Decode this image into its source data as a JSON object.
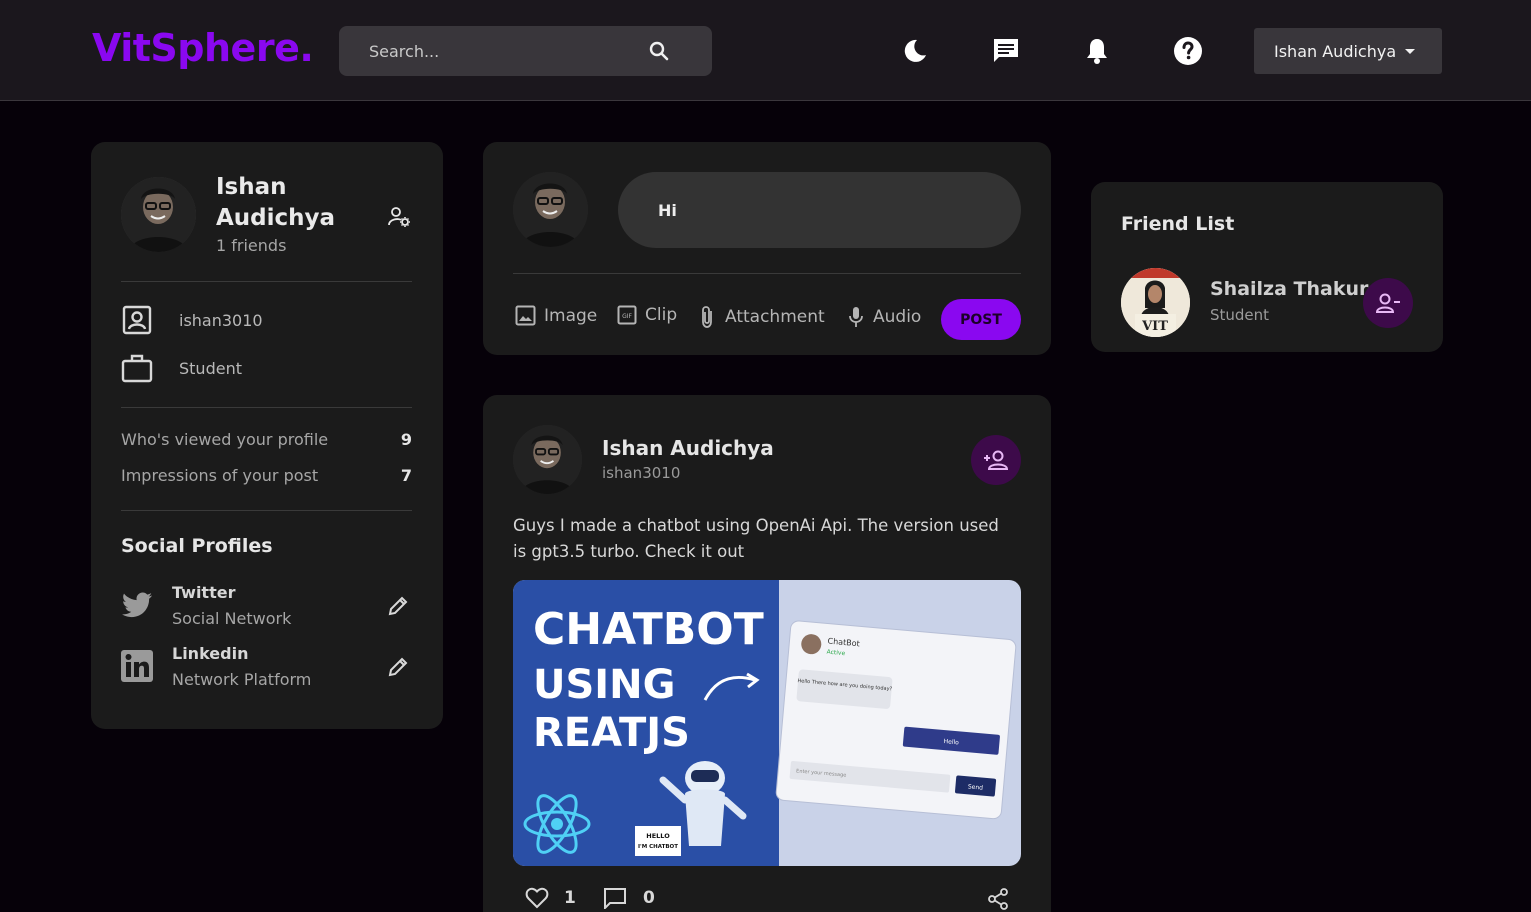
{
  "header": {
    "logo": "VitSphere.",
    "search_placeholder": "Search...",
    "user_name": "Ishan Audichya"
  },
  "profile": {
    "name": "Ishan Audichya",
    "friends": "1 friends",
    "username": "ishan3010",
    "occupation": "Student",
    "stats": [
      {
        "label": "Who's viewed your profile",
        "value": "9"
      },
      {
        "label": "Impressions of your post",
        "value": "7"
      }
    ],
    "social_title": "Social Profiles",
    "socials": [
      {
        "name": "Twitter",
        "type": "Social Network",
        "icon": "twitter-icon"
      },
      {
        "name": "Linkedin",
        "type": "Network Platform",
        "icon": "linkedin-icon"
      }
    ]
  },
  "composer": {
    "input_value": "Hi",
    "tools": [
      "Image",
      "Clip",
      "Attachment",
      "Audio"
    ],
    "post_label": "POST"
  },
  "post": {
    "author": "Ishan Audichya",
    "handle": "ishan3010",
    "text": "Guys I made a chatbot using OpenAi Api. The version used is gpt3.5 turbo. Check it out",
    "image": {
      "headline": [
        "CHATBOT",
        "USING",
        "REATJS"
      ],
      "bubble": [
        "HELLO",
        "I'M CHATBOT"
      ],
      "chat_title": "ChatBot",
      "chat_status": "Active",
      "chat_msg": "Hello There how are you doing today?",
      "chat_reply": "Hello",
      "chat_placeholder": "Enter your message",
      "chat_send": "Send"
    },
    "likes": "1",
    "comments": "0"
  },
  "friend_list": {
    "title": "Friend List",
    "friends": [
      {
        "name": "Shailza Thakur",
        "role": "Student"
      }
    ]
  },
  "colors": {
    "accent": "#8a08f0",
    "background": "#060109",
    "card": "#1b1b1b",
    "navbar": "#1b171d"
  }
}
